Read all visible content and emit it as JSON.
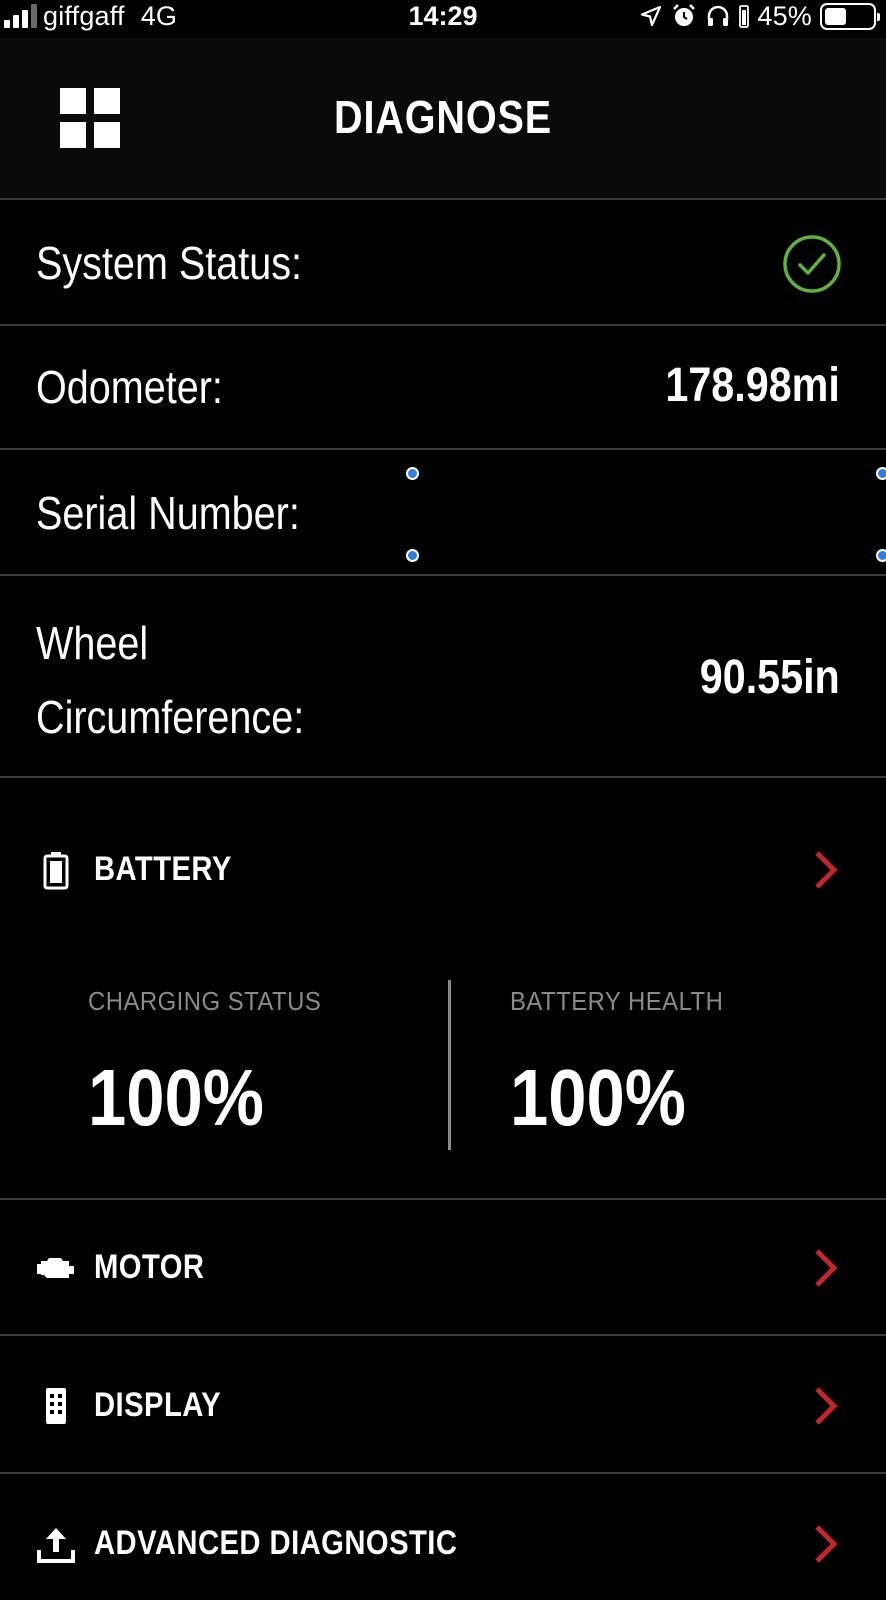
{
  "status_bar": {
    "carrier": "giffgaff",
    "network": "4G",
    "time": "14:29",
    "battery_percent": "45%",
    "battery_level": 0.45,
    "icons": [
      "location-arrow-icon",
      "alarm-icon",
      "headphones-icon"
    ]
  },
  "nav": {
    "title": "DIAGNOSE",
    "menu_icon": "grid-menu-icon"
  },
  "info": {
    "system_status_label": "System Status:",
    "system_status_state": "ok",
    "odometer_label": "Odometer:",
    "odometer_value": "178.98mi",
    "serial_label": "Serial Number:",
    "serial_value": "",
    "wheel_label_line1": "Wheel",
    "wheel_label_line2": "Circumference:",
    "wheel_value": "90.55in"
  },
  "sections": {
    "battery": {
      "label": "BATTERY",
      "icon": "battery-icon",
      "charging_label": "CHARGING STATUS",
      "charging_value": "100%",
      "health_label": "BATTERY HEALTH",
      "health_value": "100%"
    },
    "motor": {
      "label": "MOTOR",
      "icon": "motor-icon"
    },
    "display": {
      "label": "DISPLAY",
      "icon": "display-icon"
    },
    "advanced": {
      "label": "ADVANCED DIAGNOSTIC",
      "icon": "upload-icon"
    }
  },
  "colors": {
    "background": "#000000",
    "chevron": "#c0262b",
    "status_ok": "#5fb33a",
    "divider": "#3a3a3a",
    "muted_text": "#8a8a8a",
    "selection_handle": "#2f7fe0"
  }
}
